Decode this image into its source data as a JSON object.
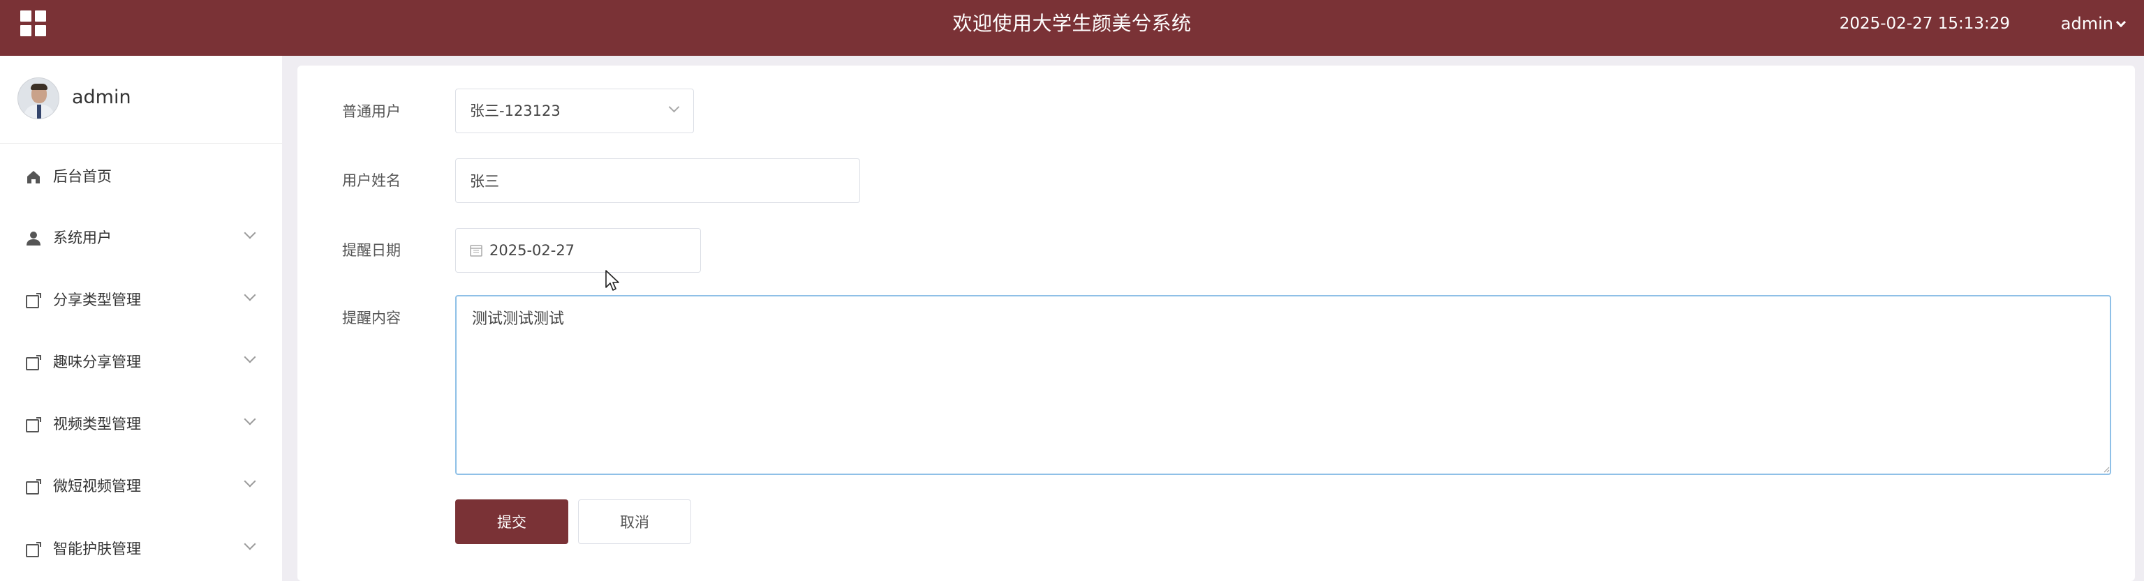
{
  "header": {
    "title": "欢迎使用大学生颜美兮系统",
    "datetime": "2025-02-27 15:13:29",
    "user": "admin",
    "bg_color": "#7a3236"
  },
  "sidebar": {
    "username": "admin",
    "items": [
      {
        "label": "后台首页",
        "icon": "home-icon",
        "has_submenu": false
      },
      {
        "label": "系统用户",
        "icon": "user-icon",
        "has_submenu": true
      },
      {
        "label": "分享类型管理",
        "icon": "folder-icon",
        "has_submenu": true
      },
      {
        "label": "趣味分享管理",
        "icon": "folder-icon",
        "has_submenu": true
      },
      {
        "label": "视频类型管理",
        "icon": "folder-icon",
        "has_submenu": true
      },
      {
        "label": "微短视频管理",
        "icon": "folder-icon",
        "has_submenu": true
      },
      {
        "label": "智能护肤管理",
        "icon": "folder-icon",
        "has_submenu": true
      }
    ]
  },
  "form": {
    "user_select": {
      "label": "普通用户",
      "value": "张三-123123"
    },
    "user_name": {
      "label": "用户姓名",
      "value": "张三"
    },
    "remind_date": {
      "label": "提醒日期",
      "value": "2025-02-27"
    },
    "remind_content": {
      "label": "提醒内容",
      "value": "测试测试测试"
    },
    "submit_label": "提交",
    "cancel_label": "取消"
  },
  "colors": {
    "primary": "#7a3236",
    "focus_border": "#8fc0e7",
    "page_bg": "#efedf2"
  }
}
